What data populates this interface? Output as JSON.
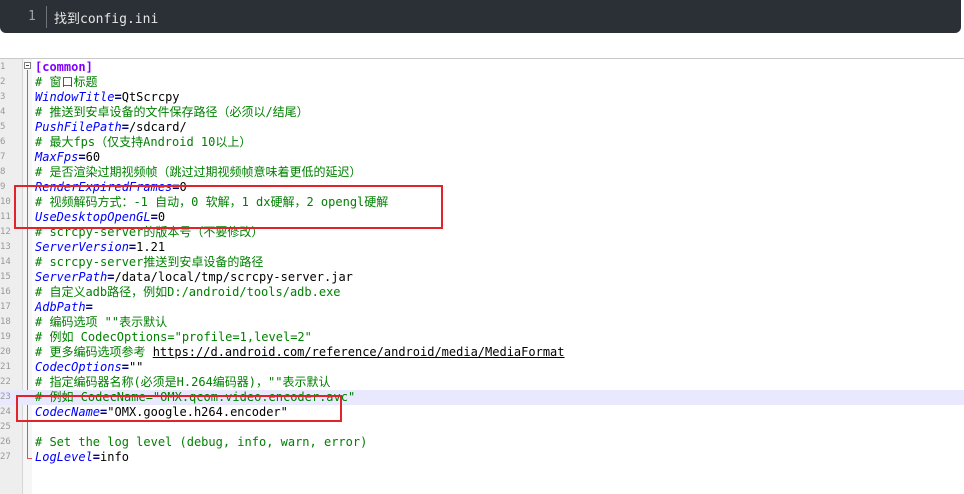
{
  "snippet": {
    "line_number": "1",
    "text": "找到config.ini"
  },
  "editor": {
    "lines": [
      {
        "n": "1",
        "section": "[common]"
      },
      {
        "n": "2",
        "comment": "# 窗口标题"
      },
      {
        "n": "3",
        "key": "WindowTitle",
        "value": "QtScrcpy"
      },
      {
        "n": "4",
        "comment": "# 推送到安卓设备的文件保存路径（必须以/结尾）"
      },
      {
        "n": "5",
        "key": "PushFilePath",
        "value": "/sdcard/"
      },
      {
        "n": "6",
        "comment": "# 最大fps（仅支持Android 10以上）"
      },
      {
        "n": "7",
        "key": "MaxFps",
        "value": "60"
      },
      {
        "n": "8",
        "comment": "# 是否渲染过期视频帧（跳过过期视频帧意味着更低的延迟）"
      },
      {
        "n": "9",
        "key": "RenderExpiredFrames",
        "value": "0"
      },
      {
        "n": "10",
        "comment": "# 视频解码方式：-1 自动，0 软解，1 dx硬解，2 opengl硬解"
      },
      {
        "n": "11",
        "key": "UseDesktopOpenGL",
        "value": "0"
      },
      {
        "n": "12",
        "comment": "# scrcpy-server的版本号（不要修改）"
      },
      {
        "n": "13",
        "key": "ServerVersion",
        "value": "1.21"
      },
      {
        "n": "14",
        "comment": "# scrcpy-server推送到安卓设备的路径"
      },
      {
        "n": "15",
        "key": "ServerPath",
        "value": "/data/local/tmp/scrcpy-server.jar"
      },
      {
        "n": "16",
        "comment": "# 自定义adb路径，例如D:/android/tools/adb.exe"
      },
      {
        "n": "17",
        "key": "AdbPath",
        "value": ""
      },
      {
        "n": "18",
        "comment": "# 编码选项 \"\"表示默认"
      },
      {
        "n": "19",
        "comment": "# 例如 CodecOptions=\"profile=1,level=2\""
      },
      {
        "n": "20",
        "comment": "# 更多编码选项参考 ",
        "url": "https://d.android.com/reference/android/media/MediaFormat"
      },
      {
        "n": "21",
        "key": "CodecOptions",
        "value": "\"\""
      },
      {
        "n": "22",
        "comment": "# 指定编码器名称(必须是H.264编码器)，\"\"表示默认"
      },
      {
        "n": "23",
        "comment": "# 例如 CodecName=\"OMX.qcom.video.encoder.avc\"",
        "highlight": true
      },
      {
        "n": "24",
        "key": "CodecName",
        "value": "\"OMX.google.h264.encoder\""
      },
      {
        "n": "25"
      },
      {
        "n": "26",
        "comment": "# Set the log level (debug, info, warn, error)"
      },
      {
        "n": "27",
        "key": "LogLevel",
        "value": "info"
      }
    ]
  },
  "colors": {
    "section": "#8000ff",
    "comment": "#008000",
    "key": "#0000ff",
    "highlight_box": "#e0242a",
    "current_line": "#e8e8ff"
  }
}
